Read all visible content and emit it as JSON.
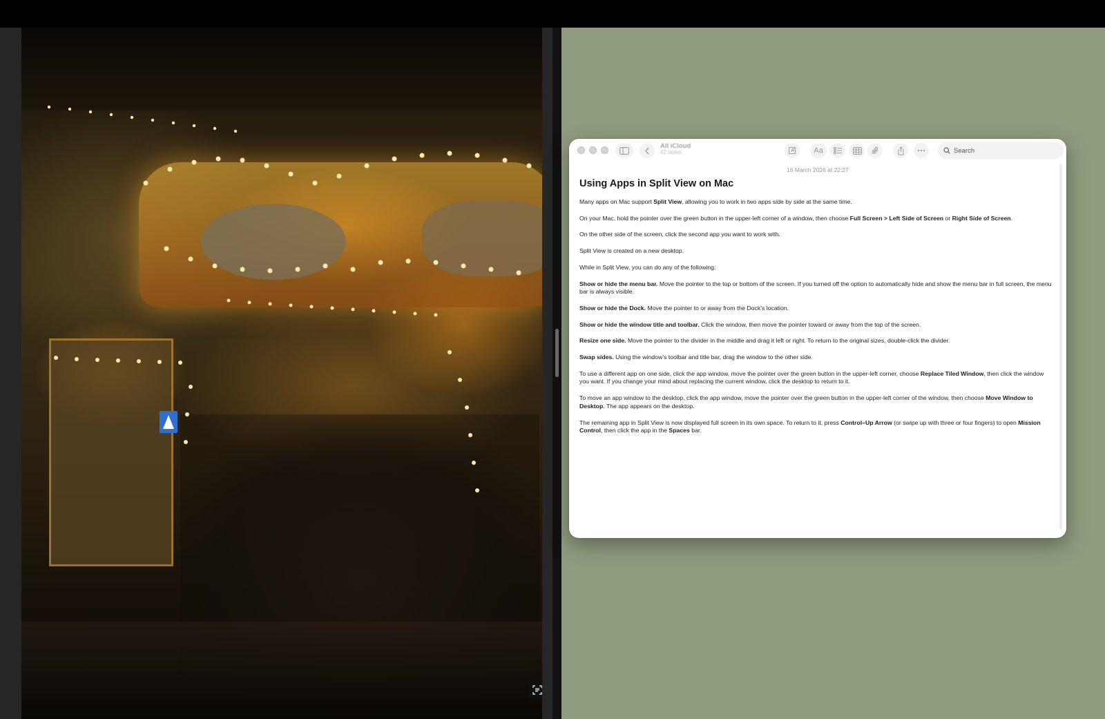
{
  "notes_app": {
    "folder_name": "All iCloud",
    "folder_count": "42 notes",
    "search_placeholder": "Search",
    "toolbar": {
      "format_label": "Aa"
    },
    "note": {
      "date": "16 March 2026 at 22:27",
      "title": "Using Apps in Split View on Mac",
      "paragraphs": [
        [
          {
            "t": "Many apps on Mac support "
          },
          {
            "t": "Split View",
            "b": true
          },
          {
            "t": ", allowing you to work in two apps side by side at the same time."
          }
        ],
        [
          {
            "t": "On your Mac, hold the pointer over the green button in the upper-left corner of a window, then choose "
          },
          {
            "t": "Full Screen > Left Side of Screen",
            "b": true
          },
          {
            "t": " or "
          },
          {
            "t": "Right Side of Screen",
            "b": true
          },
          {
            "t": "."
          }
        ],
        [
          {
            "t": "On the other side of the screen, click the second app you want to work with."
          }
        ],
        [
          {
            "t": "Split View is created on a new desktop."
          }
        ],
        [
          {
            "t": "While in Split View, you can do any of the following:"
          }
        ],
        [
          {
            "t": "Show or hide the menu bar.",
            "b": true
          },
          {
            "t": " Move the pointer to the top or bottom of the screen. If you turned off the option to automatically hide and show the menu bar in full screen, the menu bar is always visible."
          }
        ],
        [
          {
            "t": "Show or hide the Dock.",
            "b": true
          },
          {
            "t": " Move the pointer to or away from the Dock’s location."
          }
        ],
        [
          {
            "t": "Show or hide the window title and toolbar.",
            "b": true
          },
          {
            "t": " Click the window, then move the pointer toward or away from the top of the screen."
          }
        ],
        [
          {
            "t": "Resize one side.",
            "b": true
          },
          {
            "t": " Move the pointer to the divider in the middle and drag it left or right. To return to the original sizes, double-click the divider."
          }
        ],
        [
          {
            "t": "Swap sides.",
            "b": true
          },
          {
            "t": " Using the window’s toolbar and title bar, drag the window to the other side."
          }
        ],
        [
          {
            "t": "To use a different app on one side, click the app window, move the pointer over the green button in the upper-left corner, choose "
          },
          {
            "t": "Replace Tiled Window",
            "b": true
          },
          {
            "t": ", then click the window you want. If you change your mind about replacing the current window, click the desktop to return to it."
          }
        ],
        [
          {
            "t": "To move an app window to the desktop, click the app window, move the pointer over the green button in the upper-left corner of the window, then choose "
          },
          {
            "t": "Move Window to Desktop",
            "b": true
          },
          {
            "t": ". The app appears on the desktop."
          }
        ],
        [
          {
            "t": "The remaining app in Split View is now displayed full screen in its own space. To return to it, press "
          },
          {
            "t": "Control–Up Arrow",
            "b": true
          },
          {
            "t": " (or swipe up with three or four fingers) to open "
          },
          {
            "t": "Mission Control",
            "b": true
          },
          {
            "t": ", then click the app in the "
          },
          {
            "t": "Spaces",
            "b": true
          },
          {
            "t": " bar."
          }
        ]
      ]
    }
  },
  "colors": {
    "desktop": "#8f9c7e",
    "window": "#ffffff",
    "divider": "#111111"
  },
  "icons": [
    "sidebar-toggle-icon",
    "back-chevron-icon",
    "compose-icon",
    "format-text-icon",
    "checklist-icon",
    "table-icon",
    "attachment-icon",
    "share-icon",
    "more-icon",
    "search-icon",
    "live-text-icon"
  ]
}
